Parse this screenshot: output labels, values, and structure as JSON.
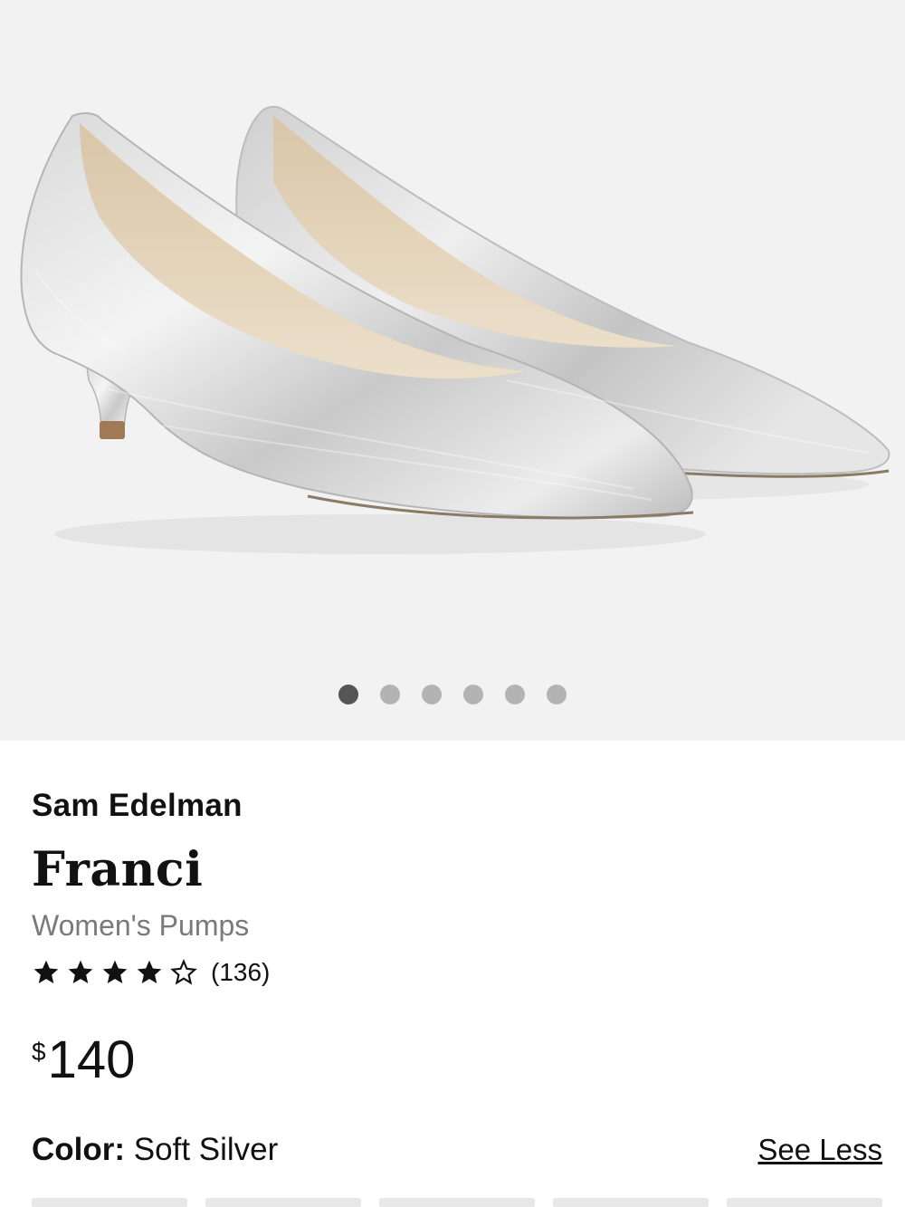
{
  "product": {
    "brand": "Sam Edelman",
    "name": "Franci",
    "category": "Women's Pumps",
    "rating": 4,
    "rating_max": 5,
    "review_count": "(136)",
    "price_currency": "$",
    "price_amount": "140"
  },
  "gallery": {
    "image_count": 6,
    "active_index": 0
  },
  "color": {
    "label": "Color:",
    "value": "Soft Silver",
    "toggle_label": "See Less"
  },
  "colors": {
    "background": "#f2f2f2",
    "dot_active": "#555555",
    "dot_inactive": "#b3b3b3",
    "muted_text": "#7a7a7a"
  }
}
